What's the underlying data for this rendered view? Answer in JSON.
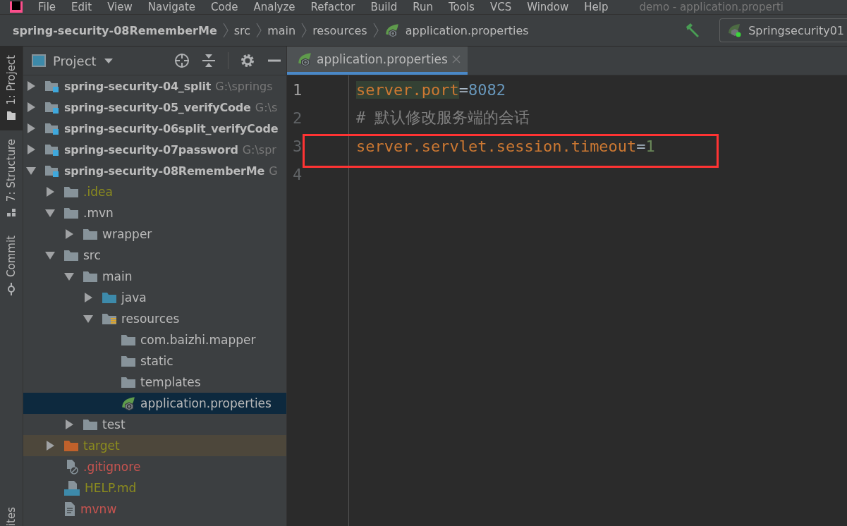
{
  "menu": [
    "File",
    "Edit",
    "View",
    "Navigate",
    "Code",
    "Analyze",
    "Refactor",
    "Build",
    "Run",
    "Tools",
    "VCS",
    "Window",
    "Help"
  ],
  "window": {
    "title": "demo - application.properti"
  },
  "breadcrumb": [
    {
      "label": "spring-security-08RememberMe",
      "kind": "module"
    },
    {
      "label": "src",
      "kind": "folder"
    },
    {
      "label": "main",
      "kind": "folder"
    },
    {
      "label": "resources",
      "kind": "folder"
    },
    {
      "label": "application.properties",
      "kind": "spring"
    }
  ],
  "run_config": {
    "label": "Springsecurity01"
  },
  "tool_strip": [
    {
      "label": "1: Project",
      "selected": true,
      "kind": "project"
    },
    {
      "label": "7: Structure",
      "selected": false,
      "kind": "structure"
    },
    {
      "label": "Commit",
      "selected": false,
      "kind": "commit"
    },
    {
      "label": "ites",
      "selected": false,
      "kind": "none"
    }
  ],
  "project_panel": {
    "title": "Project",
    "tree": [
      {
        "name": "spring-security-04_split",
        "path": "G:\\springs",
        "kind": "module",
        "expanded": false,
        "selected": false
      },
      {
        "name": "spring-security-05_verifyCode",
        "path": "G:\\s",
        "kind": "module",
        "expanded": false,
        "selected": false
      },
      {
        "name": "spring-security-06split_verifyCode",
        "kind": "module",
        "expanded": false,
        "selected": false
      },
      {
        "name": "spring-security-07password",
        "path": "G:\\spr",
        "kind": "module",
        "expanded": false,
        "selected": false
      },
      {
        "name": "spring-security-08RememberMe",
        "path": "G",
        "kind": "module",
        "expanded": true,
        "selected": false,
        "children": [
          {
            "name": ".idea",
            "kind": "folder",
            "color": "#8c8c1e",
            "expanded": false,
            "selected": false
          },
          {
            "name": ".mvn",
            "kind": "folder",
            "expanded": true,
            "selected": false,
            "children": [
              {
                "name": "wrapper",
                "kind": "folder",
                "expanded": false,
                "selected": false
              }
            ]
          },
          {
            "name": "src",
            "kind": "folder",
            "expanded": true,
            "selected": false,
            "children": [
              {
                "name": "main",
                "kind": "folder",
                "expanded": true,
                "selected": false,
                "children": [
                  {
                    "name": "java",
                    "kind": "source-folder",
                    "expanded": false,
                    "selected": false
                  },
                  {
                    "name": "resources",
                    "kind": "resources-folder",
                    "expanded": true,
                    "selected": false,
                    "children": [
                      {
                        "name": "com.baizhi.mapper",
                        "kind": "folder",
                        "selected": false
                      },
                      {
                        "name": "static",
                        "kind": "folder",
                        "selected": false
                      },
                      {
                        "name": "templates",
                        "kind": "folder",
                        "selected": false
                      },
                      {
                        "name": "application.properties",
                        "kind": "spring",
                        "selected": true
                      }
                    ]
                  }
                ]
              },
              {
                "name": "test",
                "kind": "folder",
                "expanded": false,
                "selected": false
              }
            ]
          },
          {
            "name": "target",
            "kind": "excluded-folder",
            "color": "#8c8c1e",
            "expanded": false,
            "selected": false
          },
          {
            "name": ".gitignore",
            "kind": "gitignore",
            "color": "#c75450",
            "selected": false
          },
          {
            "name": "HELP.md",
            "kind": "markdown",
            "color": "#8c8c1e",
            "selected": false
          },
          {
            "name": "mvnw",
            "kind": "text",
            "color": "#c75450",
            "selected": false
          }
        ]
      }
    ]
  },
  "editor": {
    "tabs": [
      {
        "label": "application.properties",
        "selected": true
      }
    ],
    "lines": [
      {
        "number": "1",
        "current": true,
        "annotated": false,
        "tokens": [
          {
            "kind": "key-match",
            "text": "server.port"
          },
          {
            "kind": "eq",
            "text": "="
          },
          {
            "kind": "number",
            "text": "8082"
          }
        ]
      },
      {
        "number": "2",
        "current": false,
        "annotated": false,
        "tokens": [
          {
            "kind": "comment",
            "text": "# 默认修改服务端的会话"
          }
        ]
      },
      {
        "number": "3",
        "current": false,
        "annotated": true,
        "tokens": [
          {
            "kind": "key",
            "text": "server.servlet.session.timeout"
          },
          {
            "kind": "eq",
            "text": "="
          },
          {
            "kind": "value",
            "text": "1"
          }
        ]
      },
      {
        "number": "4",
        "current": false,
        "annotated": false
      }
    ]
  }
}
